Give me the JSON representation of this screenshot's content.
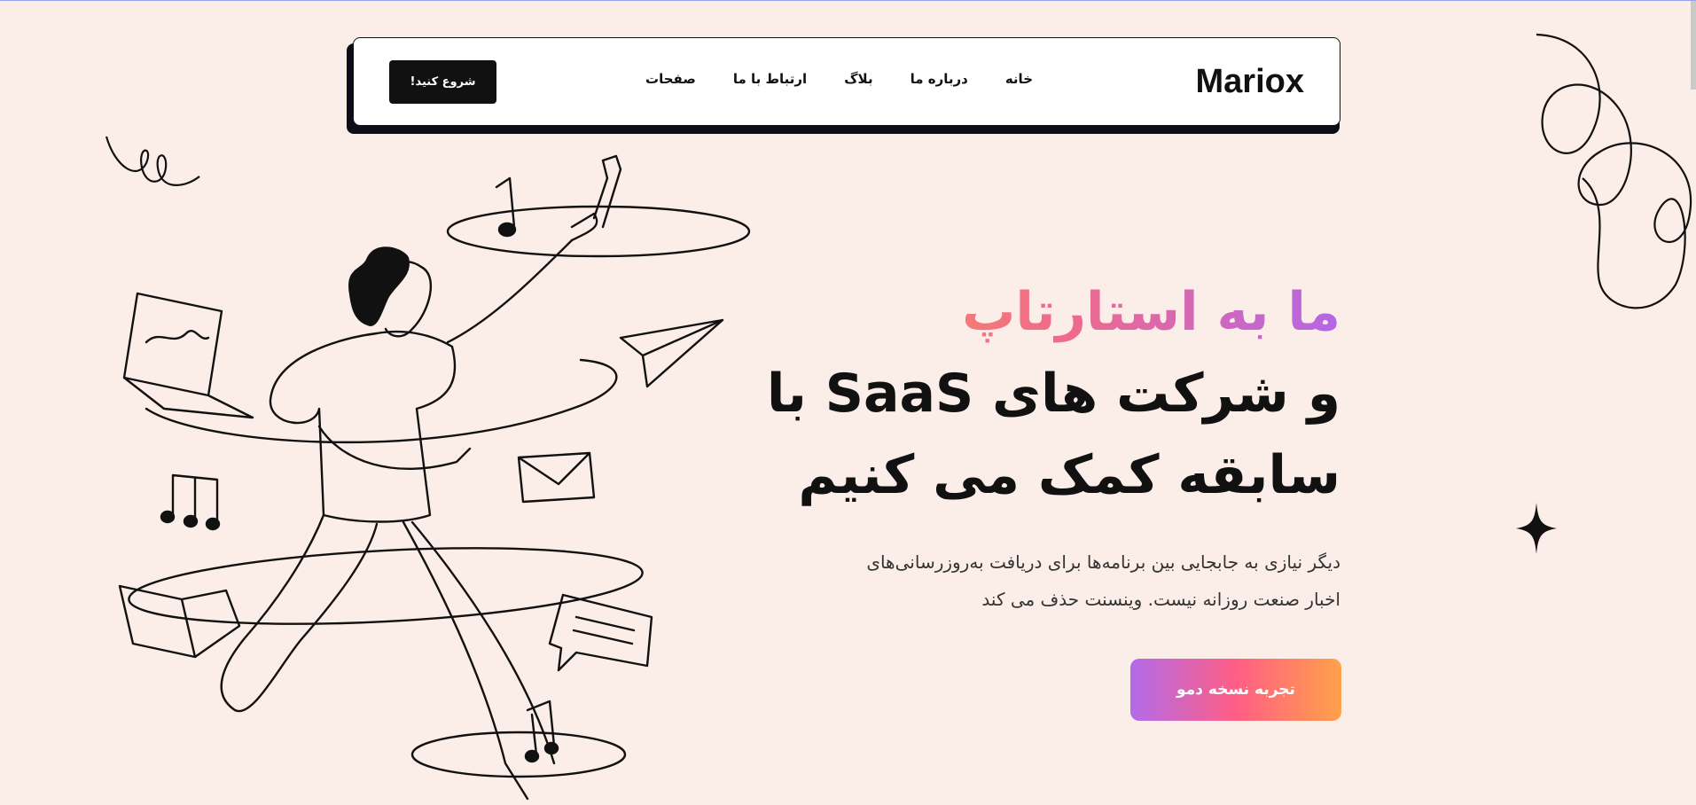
{
  "header": {
    "logo": "Mariox",
    "menu": [
      {
        "id": "home",
        "label": "خانه"
      },
      {
        "id": "about",
        "label": "درباره ما"
      },
      {
        "id": "blog",
        "label": "بلاگ"
      },
      {
        "id": "contact",
        "label": "ارتباط با ما"
      },
      {
        "id": "pages",
        "label": "صفحات"
      }
    ],
    "cta_label": "شروع کنید!"
  },
  "hero": {
    "title_highlight": "ما به استارتاپ",
    "title_line2": "و شرکت های SaaS با",
    "title_line3": "سابقه کمک می کنیم",
    "description_line1": "دیگر نیازی به جابجایی بین برنامه‌ها برای دریافت به‌روزرسانی‌های",
    "description_line2": "اخبار صنعت روزانه نیست. وینسنت حذف می کند",
    "demo_button_label": "تجربه نسخه دمو"
  },
  "colors": {
    "background": "#fbede8",
    "gradient_start": "#ffa24e",
    "gradient_mid": "#f06a8a",
    "gradient_end": "#b466e8",
    "dark": "#111111"
  },
  "icons": [
    "squiggle-icon",
    "spiral-doodle-icon",
    "sparkle-star-icon",
    "person-multitasking-illustration"
  ]
}
